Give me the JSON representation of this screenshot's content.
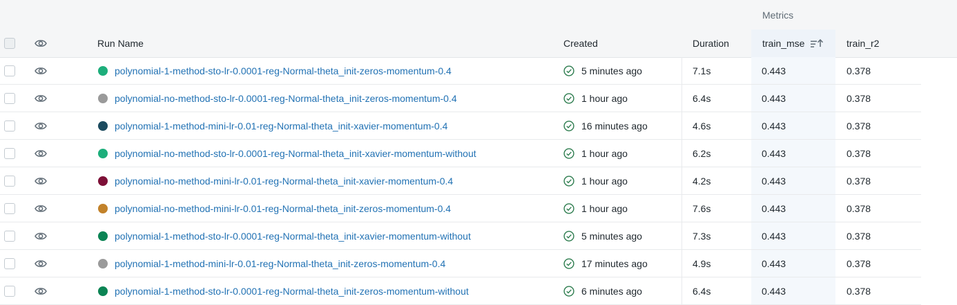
{
  "header": {
    "group_metrics": "Metrics",
    "columns": {
      "run_name": "Run Name",
      "created": "Created",
      "duration": "Duration",
      "train_mse": "train_mse",
      "train_r2": "train_r2"
    }
  },
  "colors": {
    "link": "#2272b4",
    "success": "#2e7d4f",
    "sorted_column_bg": "#f4f8fc"
  },
  "rows": [
    {
      "color": "#1dae7b",
      "run_name": "polynomial-1-method-sto-lr-0.0001-reg-Normal-theta_init-zeros-momentum-0.4",
      "created": "5 minutes ago",
      "duration": "7.1s",
      "train_mse": "0.443",
      "train_r2": "0.378"
    },
    {
      "color": "#9a9a9a",
      "run_name": "polynomial-no-method-sto-lr-0.0001-reg-Normal-theta_init-zeros-momentum-0.4",
      "created": "1 hour ago",
      "duration": "6.4s",
      "train_mse": "0.443",
      "train_r2": "0.378"
    },
    {
      "color": "#1c4b5f",
      "run_name": "polynomial-1-method-mini-lr-0.01-reg-Normal-theta_init-xavier-momentum-0.4",
      "created": "16 minutes ago",
      "duration": "4.6s",
      "train_mse": "0.443",
      "train_r2": "0.378"
    },
    {
      "color": "#1dae7b",
      "run_name": "polynomial-no-method-sto-lr-0.0001-reg-Normal-theta_init-xavier-momentum-without",
      "created": "1 hour ago",
      "duration": "6.2s",
      "train_mse": "0.443",
      "train_r2": "0.378"
    },
    {
      "color": "#7d1037",
      "run_name": "polynomial-no-method-mini-lr-0.01-reg-Normal-theta_init-xavier-momentum-0.4",
      "created": "1 hour ago",
      "duration": "4.2s",
      "train_mse": "0.443",
      "train_r2": "0.378"
    },
    {
      "color": "#c2822a",
      "run_name": "polynomial-no-method-mini-lr-0.01-reg-Normal-theta_init-zeros-momentum-0.4",
      "created": "1 hour ago",
      "duration": "7.6s",
      "train_mse": "0.443",
      "train_r2": "0.378"
    },
    {
      "color": "#0b8454",
      "run_name": "polynomial-1-method-sto-lr-0.0001-reg-Normal-theta_init-xavier-momentum-without",
      "created": "5 minutes ago",
      "duration": "7.3s",
      "train_mse": "0.443",
      "train_r2": "0.378"
    },
    {
      "color": "#9a9a9a",
      "run_name": "polynomial-1-method-mini-lr-0.01-reg-Normal-theta_init-zeros-momentum-0.4",
      "created": "17 minutes ago",
      "duration": "4.9s",
      "train_mse": "0.443",
      "train_r2": "0.378"
    },
    {
      "color": "#0b8454",
      "run_name": "polynomial-1-method-sto-lr-0.0001-reg-Normal-theta_init-zeros-momentum-without",
      "created": "6 minutes ago",
      "duration": "6.4s",
      "train_mse": "0.443",
      "train_r2": "0.378"
    }
  ]
}
